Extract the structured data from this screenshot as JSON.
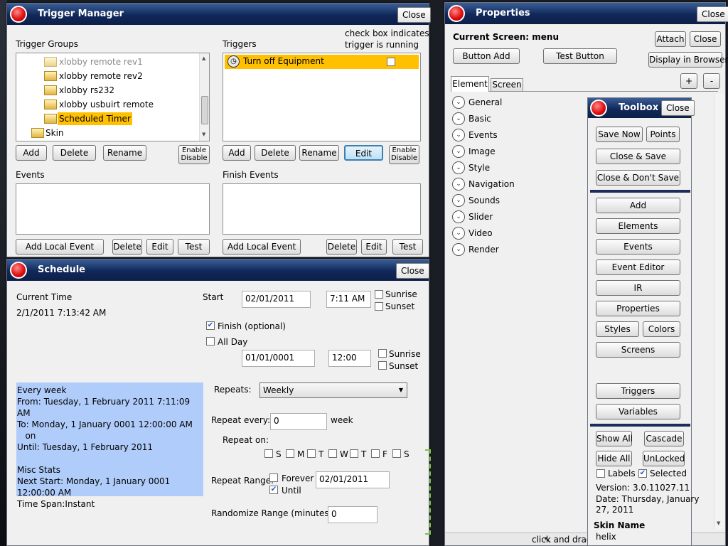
{
  "trigger_manager": {
    "title": "Trigger Manager",
    "close": "Close",
    "groups_label": "Trigger Groups",
    "groups": [
      "xlobby remote rev1",
      "xlobby remote rev2",
      "xlobby rs232",
      "xlobby usbuirt remote",
      "Scheduled Timer",
      "Skin"
    ],
    "triggers_label": "Triggers",
    "hint_line1": "check box indicates",
    "hint_line2": "trigger is running",
    "trigger_item": "Turn off Equipment",
    "add": "Add",
    "delete": "Delete",
    "rename": "Rename",
    "edit": "Edit",
    "enable1": "Enable",
    "enable2": "Disable",
    "events_label": "Events",
    "finish_events_label": "Finish Events",
    "add_local_event": "Add Local Event",
    "test": "Test"
  },
  "schedule": {
    "title": "Schedule",
    "close": "Close",
    "current_time_label": "Current Time",
    "current_time": "2/1/2011 7:13:42 AM",
    "start_label": "Start",
    "start_date": "02/01/2011",
    "start_time": "7:11 AM",
    "sunrise": "Sunrise",
    "sunset": "Sunset",
    "finish_optional": "Finish (optional)",
    "all_day": "All Day",
    "finish_date": "01/01/0001",
    "finish_time": "12:00",
    "summary_lines": [
      "Every week",
      "From: Tuesday, 1 February 2011 7:11:09 AM",
      "To: Monday, 1 January 0001 12:00:00 AM",
      "   on",
      "Until: Tuesday, 1 February 2011",
      "",
      "Misc Stats",
      "Next Start: Monday, 1 January 0001 12:00:00 AM",
      "Time Span:Instant"
    ],
    "repeats_label": "Repeats:",
    "repeats_value": "Weekly",
    "repeat_every_label": "Repeat every:",
    "repeat_every_value": "0",
    "week": "week",
    "repeat_on_label": "Repeat on:",
    "days": [
      "S",
      "M",
      "T",
      "W",
      "T",
      "F",
      "S"
    ],
    "repeat_range_label": "Repeat Range:",
    "forever": "Forever",
    "until": "Until",
    "until_date": "02/01/2011",
    "randomize_label": "Randomize Range (minutes):",
    "randomize_value": "0"
  },
  "properties": {
    "title": "Properties",
    "close": "Close",
    "current_screen": "Current Screen: menu",
    "attach": "Attach",
    "close2": "Close",
    "button_add": "Button Add",
    "test_button": "Test Button",
    "display_in_browser": "Display in Browser",
    "plus": "+",
    "minus": "-",
    "tab_element": "Element",
    "tab_screen": "Screen",
    "sections": [
      "General",
      "Basic",
      "Events",
      "Image",
      "Style",
      "Navigation",
      "Sounds",
      "Slider",
      "Video",
      "Render"
    ],
    "footer": "click and drag"
  },
  "toolbox": {
    "title": "Toolbox",
    "close": "Close",
    "save_now": "Save Now",
    "points": "Points",
    "close_save": "Close & Save",
    "close_dont_save": "Close & Don't Save",
    "add": "Add",
    "elements": "Elements",
    "events": "Events",
    "event_editor": "Event Editor",
    "ir": "IR",
    "properties": "Properties",
    "styles": "Styles",
    "colors": "Colors",
    "screens": "Screens",
    "triggers": "Triggers",
    "variables": "Variables",
    "show_all": "Show All",
    "cascade": "Cascade",
    "hide_all": "Hide All",
    "unlocked": "UnLocked",
    "labels": "Labels",
    "selected": "Selected",
    "version": "Version: 3.0.11027.11",
    "date1": "Date: Thursday, January",
    "date2": "27, 2011",
    "skin_name_label": "Skin Name",
    "skin_name": "helix"
  }
}
